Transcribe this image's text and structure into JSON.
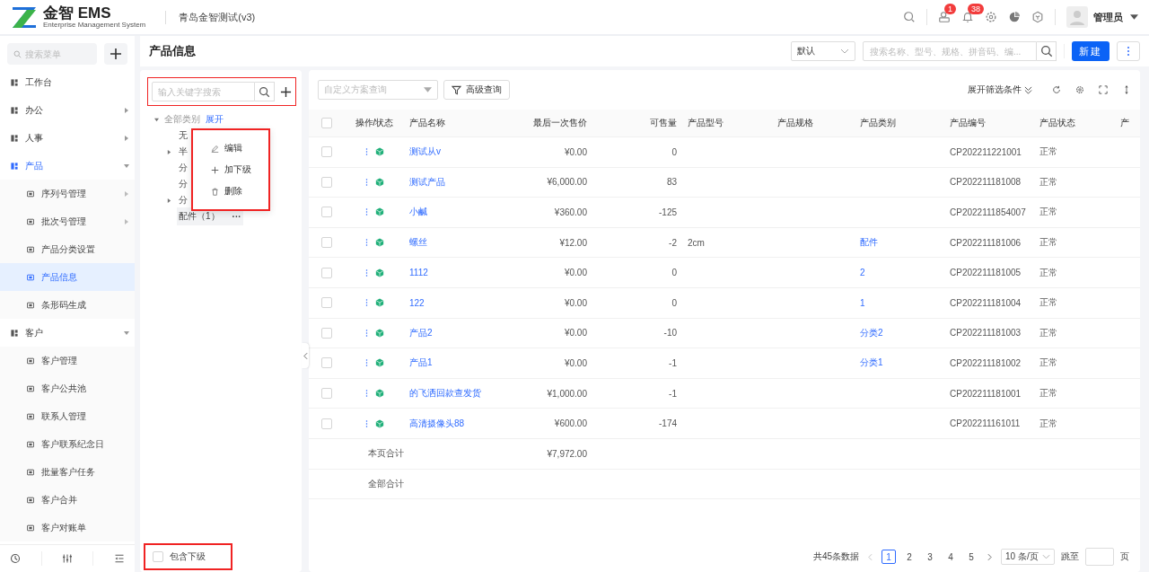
{
  "header": {
    "logo_text": "金智 EMS",
    "logo_subtitle": "Enterprise Management System",
    "org_name": "青岛金智测试(v3)",
    "message_badge": "1",
    "notification_badge": "38",
    "user_name": "管理员"
  },
  "sidebar": {
    "search_placeholder": "搜索菜单",
    "items": [
      {
        "label": "工作台",
        "selected": false,
        "has_children": false
      },
      {
        "label": "办公",
        "selected": false,
        "has_children": true,
        "expanded": false
      },
      {
        "label": "人事",
        "selected": false,
        "has_children": true,
        "expanded": false
      },
      {
        "label": "产品",
        "selected": false,
        "has_children": true,
        "expanded": true,
        "children": [
          {
            "label": "序列号管理",
            "selected": false,
            "has_children": true
          },
          {
            "label": "批次号管理",
            "selected": false,
            "has_children": true
          },
          {
            "label": "产品分类设置",
            "selected": false,
            "has_children": false
          },
          {
            "label": "产品信息",
            "selected": true,
            "has_children": false
          },
          {
            "label": "条形码生成",
            "selected": false,
            "has_children": false
          }
        ]
      },
      {
        "label": "客户",
        "selected": false,
        "has_children": true,
        "expanded": true,
        "children": [
          {
            "label": "客户管理",
            "selected": false,
            "has_children": false
          },
          {
            "label": "客户公共池",
            "selected": false,
            "has_children": false
          },
          {
            "label": "联系人管理",
            "selected": false,
            "has_children": false
          },
          {
            "label": "客户联系纪念日",
            "selected": false,
            "has_children": false
          },
          {
            "label": "批量客户任务",
            "selected": false,
            "has_children": false
          },
          {
            "label": "客户合并",
            "selected": false,
            "has_children": false
          },
          {
            "label": "客户对账单",
            "selected": false,
            "has_children": false
          }
        ]
      }
    ]
  },
  "page": {
    "title": "产品信息",
    "view_select": "默认",
    "search_placeholder": "搜索名称、型号、规格、拼音码、编...",
    "new_button": "新建"
  },
  "tree": {
    "search_placeholder": "输入关键字搜索",
    "root": {
      "label": "全部类别",
      "action": "展开",
      "expanded": true
    },
    "items": [
      {
        "label": "无",
        "has_children": false
      },
      {
        "label": "半",
        "has_children": true
      },
      {
        "label": "分",
        "has_children": false
      },
      {
        "label": "分",
        "has_children": false
      },
      {
        "label": "分",
        "has_children": true
      },
      {
        "label": "配件（1）",
        "has_children": false,
        "more": "···"
      }
    ],
    "context_menu": [
      {
        "kind": "edit",
        "label": "编辑"
      },
      {
        "kind": "add",
        "label": "加下级"
      },
      {
        "kind": "delete",
        "label": "删除"
      }
    ],
    "include_children": {
      "label": "包含下级",
      "checked": false
    }
  },
  "toolbar": {
    "scheme_placeholder": "自定义方案查询",
    "advanced_query": "高级查询",
    "expand_filters": "展开筛选条件"
  },
  "table": {
    "columns": [
      "操作/状态",
      "产品名称",
      "最后一次售价",
      "可售量",
      "产品型号",
      "产品规格",
      "产品类别",
      "产品编号",
      "产品状态",
      "产"
    ],
    "all_checked": false,
    "rows": [
      {
        "checked": false,
        "name": "测试从v",
        "price": "¥0.00",
        "qty": "0",
        "model": "",
        "category": "",
        "code": "CP202211221001",
        "status": "正常"
      },
      {
        "checked": false,
        "name": "测试产品",
        "price": "¥6,000.00",
        "qty": "83",
        "model": "",
        "category": "",
        "code": "CP202211181008",
        "status": "正常"
      },
      {
        "checked": false,
        "name": "小鹹",
        "price": "¥360.00",
        "qty": "-125",
        "model": "",
        "category": "",
        "code": "CP2022111854007",
        "status": "正常"
      },
      {
        "checked": false,
        "name": "螺丝",
        "price": "¥12.00",
        "qty": "-2",
        "model": "2cm",
        "category": "配件",
        "code": "CP202211181006",
        "status": "正常"
      },
      {
        "checked": false,
        "name": "1112",
        "price": "¥0.00",
        "qty": "0",
        "model": "",
        "category": "2",
        "code": "CP202211181005",
        "status": "正常"
      },
      {
        "checked": false,
        "name": "122",
        "price": "¥0.00",
        "qty": "0",
        "model": "",
        "category": "1",
        "code": "CP202211181004",
        "status": "正常"
      },
      {
        "checked": false,
        "name": "产品2",
        "price": "¥0.00",
        "qty": "-10",
        "model": "",
        "category": "分类2",
        "code": "CP202211181003",
        "status": "正常"
      },
      {
        "checked": false,
        "name": "产品1",
        "price": "¥0.00",
        "qty": "-1",
        "model": "",
        "category": "分类1",
        "code": "CP202211181002",
        "status": "正常"
      },
      {
        "checked": false,
        "name": "的飞洒回款查发货",
        "price": "¥1,000.00",
        "qty": "-1",
        "model": "",
        "category": "",
        "code": "CP202211181001",
        "status": "正常"
      },
      {
        "checked": false,
        "name": "高清摄像头88",
        "price": "¥600.00",
        "qty": "-174",
        "model": "",
        "category": "",
        "code": "CP202211161011",
        "status": "正常"
      }
    ],
    "summary": [
      {
        "label": "本页合计",
        "price": "¥7,972.00"
      },
      {
        "label": "全部合计"
      }
    ]
  },
  "pagination": {
    "total": "共45条数据",
    "pages": [
      {
        "label": "1",
        "selected": true
      },
      {
        "label": "2",
        "selected": false
      },
      {
        "label": "3",
        "selected": false
      },
      {
        "label": "4",
        "selected": false
      },
      {
        "label": "5",
        "selected": false
      }
    ],
    "page_size": "10 条/页",
    "jump_label": "跳至",
    "page_unit": "页"
  }
}
